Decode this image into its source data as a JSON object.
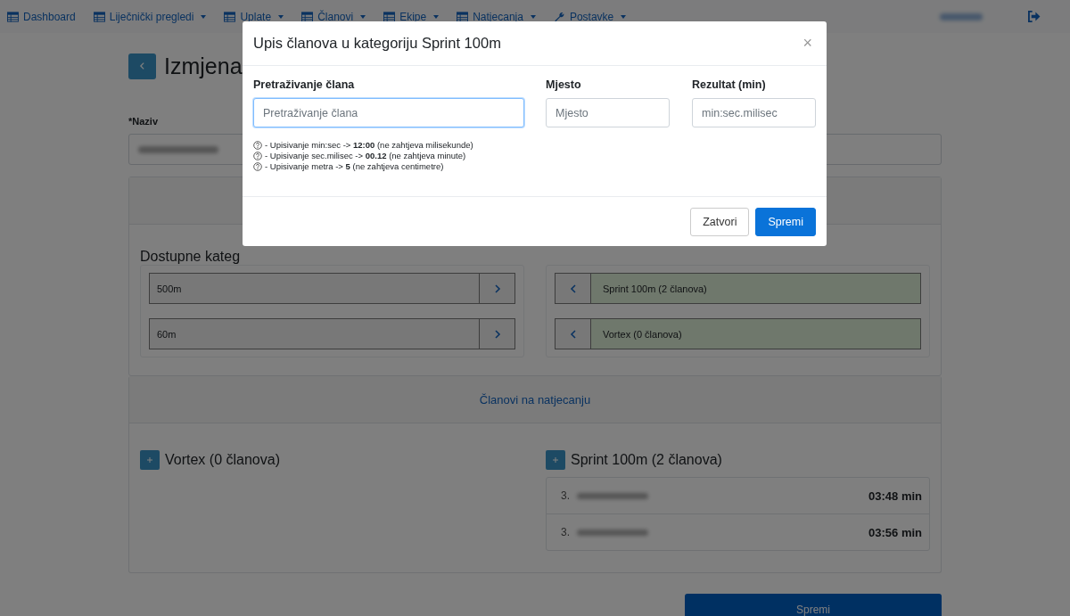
{
  "nav": {
    "items": [
      {
        "label": "Dashboard",
        "dropdown": false
      },
      {
        "label": "Liječnički pregledi",
        "dropdown": true
      },
      {
        "label": "Uplate",
        "dropdown": true
      },
      {
        "label": "Članovi",
        "dropdown": true
      },
      {
        "label": "Ekipe",
        "dropdown": true
      },
      {
        "label": "Natjecanja",
        "dropdown": true
      },
      {
        "label": "Postavke",
        "dropdown": true
      }
    ]
  },
  "page": {
    "title": "Izmjena",
    "name_label": "*Naziv",
    "available_heading": "Dostupne kateg",
    "available": [
      {
        "label": "500m"
      },
      {
        "label": "60m"
      }
    ],
    "selected": [
      {
        "label": "Sprint 100m (2 članova)"
      },
      {
        "label": "Vortex (0 članova)"
      }
    ],
    "members_tab": "Članovi na natjecanju",
    "groups": [
      {
        "title": "Vortex (0 članova)"
      },
      {
        "title": "Sprint 100m (2 članova)",
        "entries": [
          {
            "place": "3.",
            "time": "03:48 min"
          },
          {
            "place": "3.",
            "time": "03:56 min"
          }
        ]
      }
    ],
    "save": "Spremi"
  },
  "modal": {
    "title": "Upis članova u kategoriju Sprint 100m",
    "close": "×",
    "fields": [
      {
        "label": "Pretraživanje člana",
        "placeholder": "Pretraživanje člana",
        "focused": true
      },
      {
        "label": "Mjesto",
        "placeholder": "Mjesto",
        "focused": false
      },
      {
        "label": "Rezultat (min)",
        "placeholder": "min:sec.milisec",
        "focused": false
      }
    ],
    "hints": [
      "- Upisivanje min:sec -> **12:00** (ne zahtjeva milisekunde)",
      "- Upisivanje sec.milisec -> **00.12** (ne zahtjeva minute)",
      "- Upisivanje metra -> **5** (ne zahtjeva centimetre)"
    ],
    "buttons": [
      {
        "label": "Zatvori",
        "kind": "secondary"
      },
      {
        "label": "Spremi",
        "kind": "primary"
      }
    ]
  }
}
